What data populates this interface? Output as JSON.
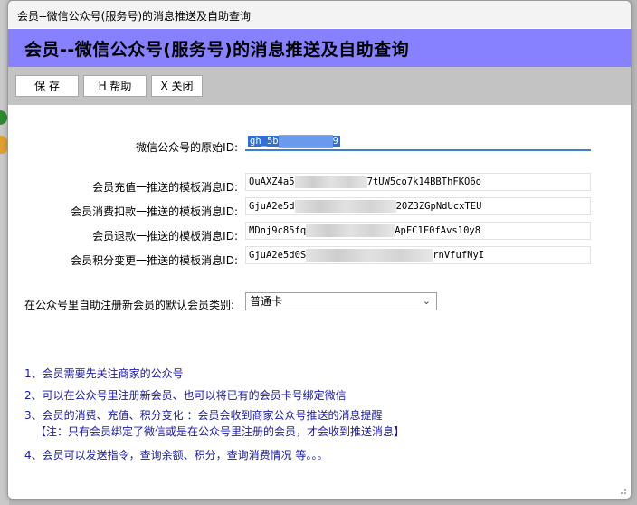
{
  "window": {
    "title": "会员--微信公众号(服务号)的消息推送及自助查询"
  },
  "banner": {
    "heading": "会员--微信公众号(服务号)的消息推送及自助查询"
  },
  "toolbar": {
    "save": "保 存",
    "help": "H 帮助",
    "close": "X 关闭"
  },
  "form": {
    "original_id": {
      "label": "微信公众号的原始ID:",
      "value_start": "gh_5b",
      "value_end": "9"
    },
    "recharge": {
      "label": "会员充值一推送的模板消息ID:",
      "value_start": "OuAXZ4a5",
      "value_end": "7tUW5co7k14BBThFKO6o"
    },
    "deduct": {
      "label": "会员消费扣款一推送的模板消息ID:",
      "value_start": "GjuA2e5d",
      "value_end": "2OZ3ZGpNdUcxTEU"
    },
    "refund": {
      "label": "会员退款一推送的模板消息ID:",
      "value_start": "MDnj9c85fq",
      "value_end": "ApFC1F0fAvs10y8"
    },
    "points": {
      "label": "会员积分变更一推送的模板消息ID:",
      "value_start": "GjuA2e5d0S",
      "value_end": "rnVfufNyI"
    },
    "default_type": {
      "label": "在公众号里自助注册新会员的默认会员类别:",
      "value": "普通卡"
    }
  },
  "notes": [
    "1、会员需要先关注商家的公众号",
    "2、可以在公众号里注册新会员、也可以将已有的会员卡号绑定微信",
    "3、会员的消费、充值、积分变化 ：会员会收到商家公众号推送的消息提醒",
    "【注：只有会员绑定了微信或是在公众号里注册的会员，才会收到推送消息】",
    "4、会员可以发送指令，查询余额、积分，查询消费情况 等。。。"
  ],
  "colors": {
    "banner": "#8780ff",
    "note_text": "#1a1aa8",
    "selection": "#2f6fd6"
  }
}
